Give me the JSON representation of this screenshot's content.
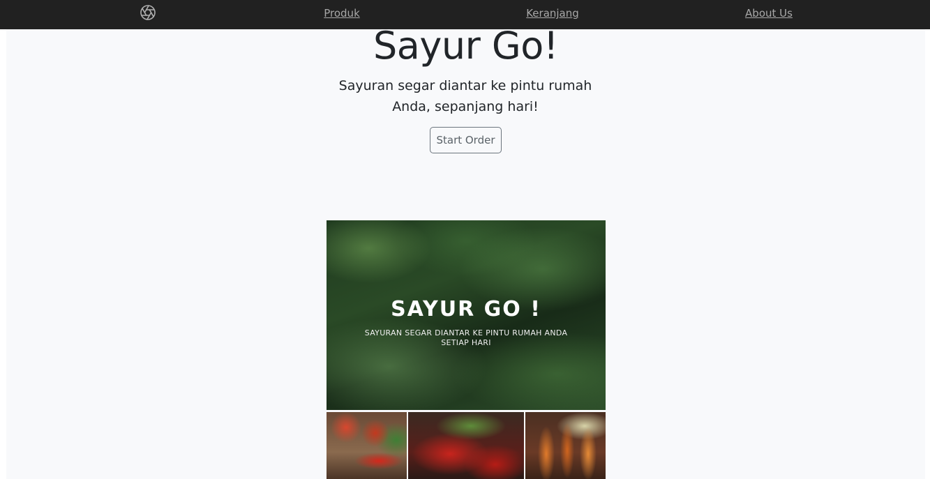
{
  "nav": {
    "logo_icon": "aperture-icon",
    "links": [
      "Produk",
      "Keranjang",
      "About Us"
    ]
  },
  "hero": {
    "title": "Sayur Go!",
    "subtitle": "Sayuran segar diantar ke pintu rumah Anda, sepanjang hari!",
    "button_label": "Start Order"
  },
  "banner": {
    "title": "SAYUR GO !",
    "tagline": "SAYURAN SEGAR DIANTAR KE PINTU RUMAH ANDA SETIAP HARI"
  },
  "colors": {
    "navbar_bg": "#212121",
    "nav_link": "#a8a8a8",
    "page_bg": "#f8f9fb",
    "button_border": "#6c757d"
  }
}
